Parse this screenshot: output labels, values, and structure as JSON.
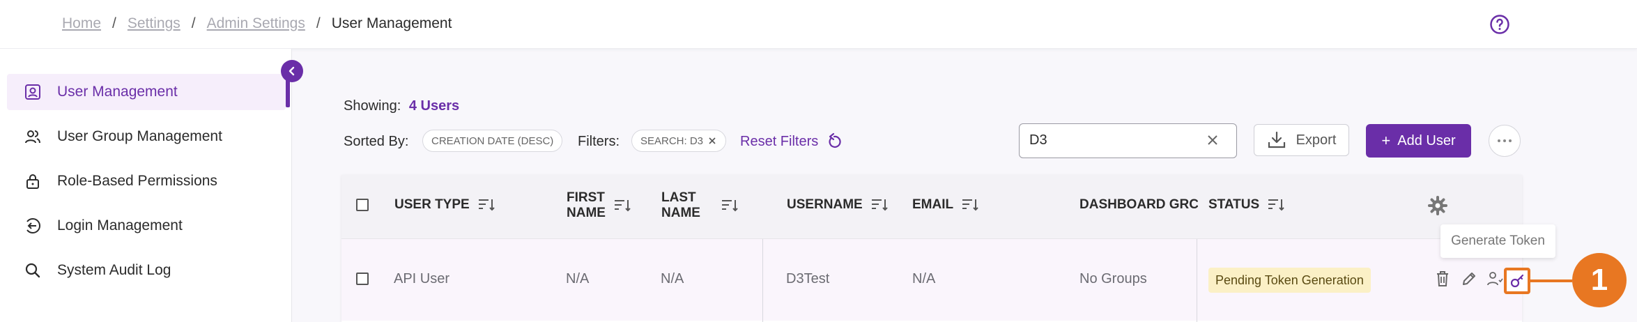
{
  "breadcrumb": {
    "items": [
      "Home",
      "Settings",
      "Admin Settings"
    ],
    "separator": "/",
    "current": "User Management"
  },
  "sidebar": {
    "items": [
      {
        "label": "User Management",
        "icon": "user-profile-icon",
        "active": true
      },
      {
        "label": "User Group Management",
        "icon": "users-icon"
      },
      {
        "label": "Role-Based Permissions",
        "icon": "lock-icon"
      },
      {
        "label": "Login Management",
        "icon": "login-icon"
      },
      {
        "label": "System Audit Log",
        "icon": "search-icon"
      }
    ]
  },
  "toolbar": {
    "showing_label": "Showing:",
    "showing_count": "4 Users",
    "sorted_label": "Sorted By:",
    "sort_chip": "CREATION DATE (DESC)",
    "filters_label": "Filters:",
    "filter_chip": "SEARCH: D3",
    "reset_label": "Reset Filters",
    "search_value": "D3",
    "export_label": "Export",
    "add_user_label": "Add User",
    "add_user_icon": "+"
  },
  "table": {
    "columns": [
      "USER TYPE",
      "FIRST NAME",
      "LAST NAME",
      "USERNAME",
      "EMAIL",
      "DASHBOARD GRC",
      "STATUS"
    ],
    "first_name_lines": [
      "FIRST",
      "NAME"
    ],
    "last_name_lines": [
      "LAST",
      "NAME"
    ],
    "rows": [
      {
        "user_type": "API User",
        "first_name": "N/A",
        "last_name": "N/A",
        "username": "D3Test",
        "email": "N/A",
        "dashboard_groups": "No Groups",
        "status": "Pending Token Generation"
      }
    ]
  },
  "tooltip": "Generate Token",
  "callout_number": "1",
  "colors": {
    "accent": "#6a2ea8",
    "callout": "#e87722",
    "status_badge_bg": "#fbf0c6"
  }
}
